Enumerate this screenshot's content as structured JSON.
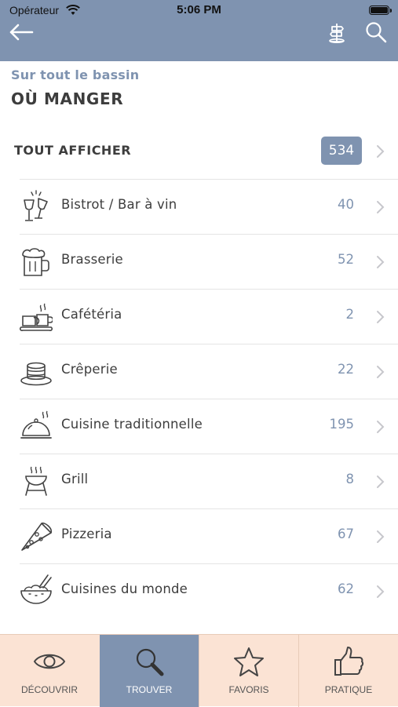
{
  "status_bar": {
    "carrier": "Opérateur",
    "time": "5:06 PM"
  },
  "header": {
    "back_icon": "arrow-left-icon",
    "map_icon": "signpost-icon",
    "search_icon": "search-icon",
    "background": "#7f93b0"
  },
  "page": {
    "subtitle": "Sur tout le bassin",
    "title": "OÙ MANGER"
  },
  "all": {
    "label": "TOUT AFFICHER",
    "count": "534"
  },
  "categories": [
    {
      "label": "Bistrot / Bar à vin",
      "count": "40",
      "icon": "wine-glasses-icon"
    },
    {
      "label": "Brasserie",
      "count": "52",
      "icon": "beer-mug-icon"
    },
    {
      "label": "Cafétéria",
      "count": "2",
      "icon": "coffee-cup-icon"
    },
    {
      "label": "Crêperie",
      "count": "22",
      "icon": "crepe-stack-icon"
    },
    {
      "label": "Cuisine traditionnelle",
      "count": "195",
      "icon": "cloche-icon"
    },
    {
      "label": "Grill",
      "count": "8",
      "icon": "grill-icon"
    },
    {
      "label": "Pizzeria",
      "count": "67",
      "icon": "pizza-slice-icon"
    },
    {
      "label": "Cuisines du monde",
      "count": "62",
      "icon": "bowl-chopsticks-icon"
    }
  ],
  "tabs": [
    {
      "label": "DÉCOUVRIR",
      "icon": "eye-icon"
    },
    {
      "label": "TROUVER",
      "icon": "search-icon",
      "active": true
    },
    {
      "label": "FAVORIS",
      "icon": "star-icon"
    },
    {
      "label": "PRATIQUE",
      "icon": "thumbs-up-icon"
    }
  ],
  "colors": {
    "accent": "#7f93b0",
    "tabbar": "#fbe3d4",
    "text": "#3d3d3d"
  }
}
